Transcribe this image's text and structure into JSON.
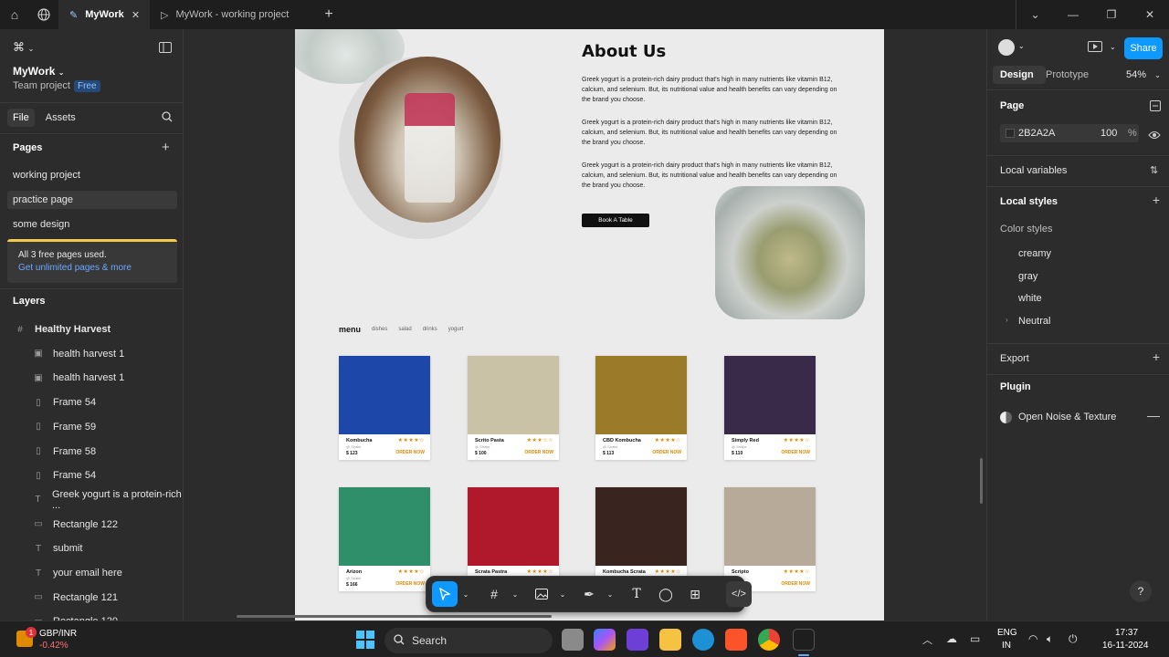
{
  "titlebar": {
    "tabs": [
      {
        "label": "MyWork",
        "active": true
      },
      {
        "label": "MyWork - working project",
        "active": false
      }
    ]
  },
  "left_panel": {
    "workspace_name": "MyWork",
    "team_label": "Team project",
    "plan_badge": "Free",
    "tab_file": "File",
    "tab_assets": "Assets",
    "pages_heading": "Pages",
    "pages": [
      "working project",
      "practice page",
      "some design"
    ],
    "selected_page": "practice page",
    "notice_text": "All 3 free pages used.",
    "notice_link": "Get unlimited pages & more",
    "layers_heading": "Layers",
    "layers": [
      {
        "name": "Healthy Harvest",
        "icon": "frame-icon"
      },
      {
        "name": "health harvest 1",
        "icon": "image-icon"
      },
      {
        "name": "health harvest 1",
        "icon": "image-icon"
      },
      {
        "name": "Frame 54",
        "icon": "autolayout-icon"
      },
      {
        "name": "Frame 59",
        "icon": "autolayout-icon"
      },
      {
        "name": "Frame 58",
        "icon": "autolayout-icon"
      },
      {
        "name": "Frame 54",
        "icon": "autolayout-icon"
      },
      {
        "name": "Greek yogurt is a protein-rich ...",
        "icon": "text-icon"
      },
      {
        "name": "Rectangle 122",
        "icon": "rectangle-icon"
      },
      {
        "name": "submit",
        "icon": "text-icon"
      },
      {
        "name": "your email here",
        "icon": "text-icon"
      },
      {
        "name": "Rectangle 121",
        "icon": "rectangle-icon"
      },
      {
        "name": "Rectangle 120",
        "icon": "rectangle-icon"
      }
    ]
  },
  "canvas": {
    "about_title": "About Us",
    "about_paragraphs": [
      "Greek yogurt is a protein-rich dairy product that's high in many nutrients like vitamin B12, calcium, and selenium. But, its nutritional value and health benefits can vary depending on the brand you choose.",
      "Greek yogurt is a protein-rich dairy product that's high in many nutrients like vitamin B12, calcium, and selenium. But, its nutritional value and health benefits can vary depending on the brand you choose.",
      "Greek yogurt is a protein-rich dairy product that's high in many nutrients like vitamin B12, calcium, and selenium. But, its nutritional value and health benefits can vary depending on the brand you choose."
    ],
    "book_button": "Book A Table",
    "menu_title": "menu",
    "menu_tabs": [
      "dishes",
      "salad",
      "drinks",
      "yogurt"
    ],
    "cards": [
      {
        "name": "Kombucha",
        "sub": "@ Shake",
        "price": "$ 123",
        "stars": "★★★★☆",
        "cta": "ORDER NOW",
        "color": "#1d47a8"
      },
      {
        "name": "Scrito Pasta",
        "sub": "@ Shake",
        "price": "$ 100",
        "stars": "★★★☆☆",
        "cta": "ORDER NOW",
        "color": "#c9c2a6"
      },
      {
        "name": "CBD Kombucha",
        "sub": "@ Shake",
        "price": "$ 113",
        "stars": "★★★★☆",
        "cta": "ORDER NOW",
        "color": "#9b7a2a"
      },
      {
        "name": "Simply Red",
        "sub": "@ Shake",
        "price": "$ 110",
        "stars": "★★★★☆",
        "cta": "ORDER NOW",
        "color": "#3a2a4a"
      },
      {
        "name": "Arizon",
        "sub": "@ Shake",
        "price": "$ 166",
        "stars": "★★★★☆",
        "cta": "ORDER NOW",
        "color": "#2e8f6a"
      },
      {
        "name": "Scrata Pastra",
        "sub": "",
        "price": "",
        "stars": "★★★★☆",
        "cta": "",
        "color": "#b0182c"
      },
      {
        "name": "Kombucha Scrata",
        "sub": "",
        "price": "",
        "stars": "★★★★☆",
        "cta": "",
        "color": "#3a2420"
      },
      {
        "name": "Scripto",
        "sub": "",
        "price": "",
        "stars": "★★★★☆",
        "cta": "ORDER NOW",
        "color": "#b8aa98"
      }
    ]
  },
  "right_panel": {
    "share_label": "Share",
    "tab_design": "Design",
    "tab_prototype": "Prototype",
    "zoom": "54%",
    "page_heading": "Page",
    "page_color": "2B2A2A",
    "page_opacity": "100",
    "opacity_unit": "%",
    "local_variables": "Local variables",
    "local_styles": "Local styles",
    "color_styles": "Color styles",
    "styles": [
      "creamy",
      "gray",
      "white",
      "Neutral"
    ],
    "export": "Export",
    "plugin": "Plugin",
    "plugin_name": "Open Noise & Texture",
    "help": "?"
  },
  "taskbar": {
    "ticker": "GBP/INR",
    "ticker_change": "-0.42%",
    "notif_count": "1",
    "search": "Search",
    "lang1": "ENG",
    "lang2": "IN",
    "time": "17:37",
    "date": "16-11-2024"
  }
}
